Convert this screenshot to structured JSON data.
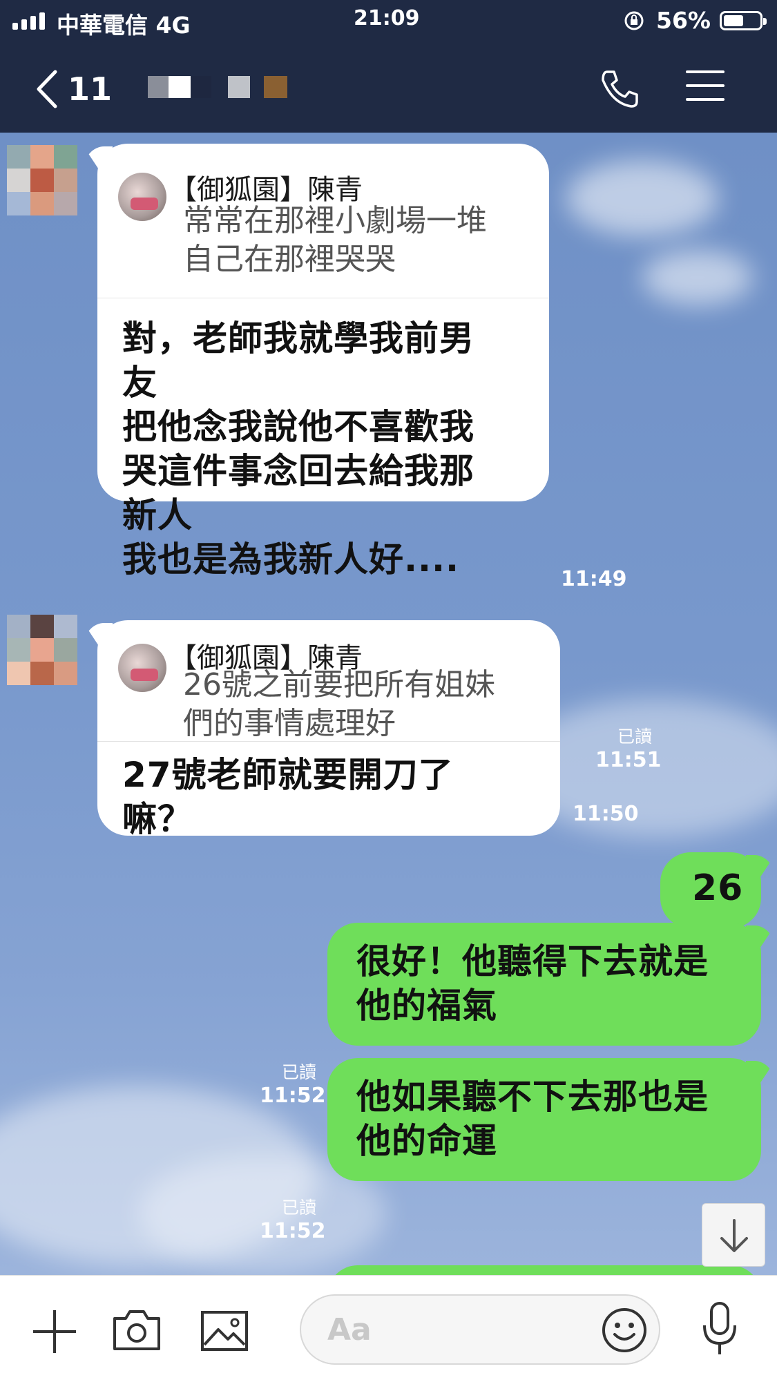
{
  "status_bar": {
    "carrier": "中華電信 4G",
    "time": "21:09",
    "battery": "56%",
    "battery_level": 0.56
  },
  "nav": {
    "back_count": "11"
  },
  "messages": [
    {
      "reply_name": "【御狐園】陳青",
      "reply_text_1": "常常在那裡小劇場一堆",
      "reply_text_2": "自己在那裡哭哭",
      "lines": [
        "對，老師我就學我前男",
        "友",
        "把他念我說他不喜歡我",
        "哭這件事念回去給我那",
        "新人",
        "我也是為我新人好...."
      ],
      "time": "11:49"
    },
    {
      "reply_name": "【御狐園】陳青",
      "reply_text_1": "26號之前要把所有姐妹",
      "reply_text_2": "們的事情處理好",
      "lines": [
        "27號老師就要開刀了",
        "嘛？"
      ],
      "time": "11:50"
    }
  ],
  "sent": [
    {
      "read": "已讀",
      "time": "11:51",
      "line1": "26",
      "line2": ""
    },
    {
      "read": "已讀",
      "time": "11:52",
      "line1": "很好！他聽得下去就是",
      "line2": "他的福氣"
    },
    {
      "read": "已讀",
      "time": "11:52",
      "line1": "他如果聽不下去那也是",
      "line2": "他的命運"
    }
  ],
  "input": {
    "placeholder": "Aa"
  }
}
